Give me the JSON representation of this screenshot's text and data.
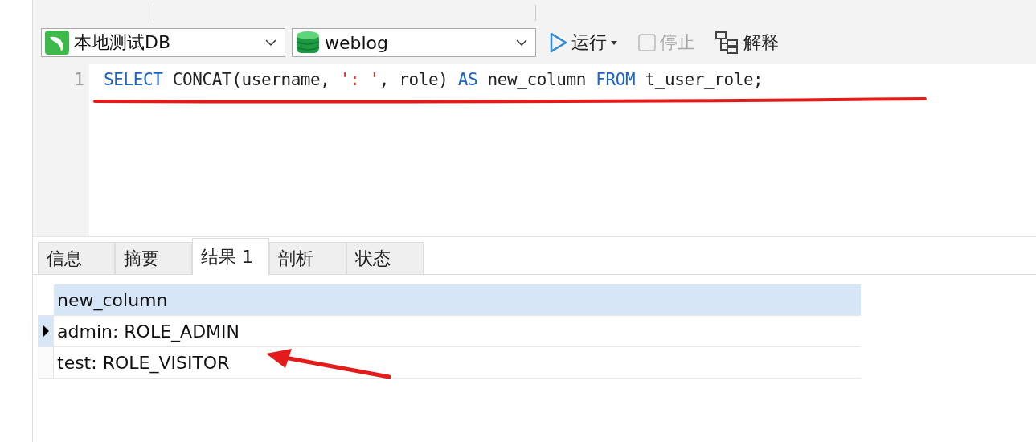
{
  "connection": {
    "value": "本地测试DB"
  },
  "database": {
    "value": "weblog"
  },
  "actions": [
    {
      "label": "运行",
      "kind": "run",
      "disabled": false
    },
    {
      "label": "停止",
      "kind": "stop",
      "disabled": true
    },
    {
      "label": "解释",
      "kind": "explain",
      "disabled": false
    }
  ],
  "editor": {
    "lines": [
      {
        "number": "1",
        "tokens": [
          {
            "text": "SELECT",
            "kind": "keyword"
          },
          {
            "text": " CONCAT(username, ",
            "kind": "plain"
          },
          {
            "text": "': '",
            "kind": "string"
          },
          {
            "text": ", role) ",
            "kind": "plain"
          },
          {
            "text": "AS",
            "kind": "keyword"
          },
          {
            "text": " new_column ",
            "kind": "plain"
          },
          {
            "text": "FROM",
            "kind": "keyword"
          },
          {
            "text": " t_user_role;",
            "kind": "plain"
          }
        ]
      }
    ]
  },
  "result_tabs": [
    {
      "label": "信息",
      "selected": false
    },
    {
      "label": "摘要",
      "selected": false
    },
    {
      "label": "结果 1",
      "selected": true
    },
    {
      "label": "剖析",
      "selected": false
    },
    {
      "label": "状态",
      "selected": false
    }
  ],
  "table": {
    "columns": [
      "new_column"
    ],
    "rows": [
      {
        "cells": [
          "admin: ROLE_ADMIN"
        ],
        "selected": true
      },
      {
        "cells": [
          "test: ROLE_VISITOR"
        ],
        "selected": false
      }
    ]
  }
}
